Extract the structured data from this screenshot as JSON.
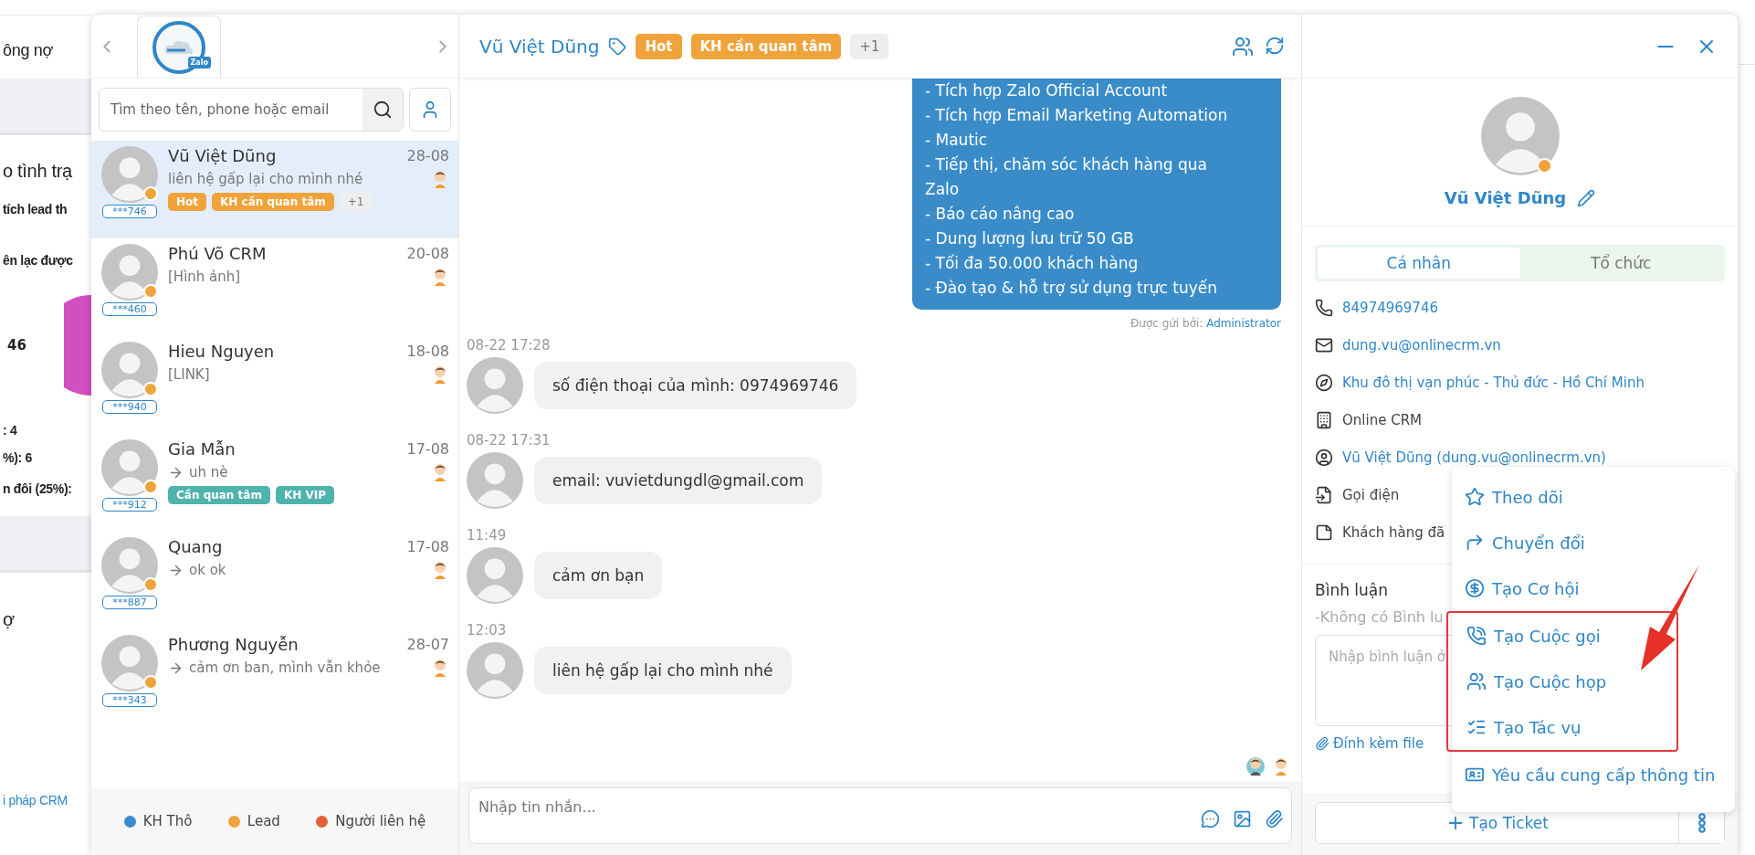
{
  "background": {
    "texts": [
      {
        "kind": "heading",
        "text": "ông nợ"
      },
      {
        "kind": "band"
      },
      {
        "kind": "title",
        "text": "o tình trạ"
      },
      {
        "kind": "bold",
        "text": "tích lead th"
      },
      {
        "kind": "bold",
        "text": "ên lạc được"
      },
      {
        "kind": "chart",
        "text": "46"
      },
      {
        "kind": "bold",
        "text": ": 4"
      },
      {
        "kind": "bold",
        "text": "%): 6"
      },
      {
        "kind": "bold",
        "text": "n đôi (25%):"
      },
      {
        "kind": "band"
      },
      {
        "kind": "title",
        "text": "ợ"
      },
      {
        "kind": "link",
        "text": "i pháp CRM"
      }
    ]
  },
  "contacts_panel": {
    "logo_text": "Zalo",
    "search": {
      "placeholder": "Tìm theo tên, phone hoặc email"
    },
    "contacts": [
      {
        "name": "Vũ Việt Dũng",
        "date": "28-08",
        "preview": "liên hệ gấp lại cho mình nhé",
        "outgoing": false,
        "phone": "***746",
        "color": "#f0a33a",
        "selected": true,
        "tags": [
          {
            "label": "Hot",
            "color": "#f0a33a"
          },
          {
            "label": "KH cần quan tâm",
            "color": "#f0a33a"
          }
        ],
        "more_tags": "+1"
      },
      {
        "name": "Phú Võ CRM",
        "date": "20-08",
        "preview": "[Hình ảnh]",
        "outgoing": false,
        "phone": "***460",
        "color": "#f0a33a",
        "selected": false
      },
      {
        "name": "Hieu Nguyen",
        "date": "18-08",
        "preview": "[LINK]",
        "outgoing": false,
        "phone": "***940",
        "color": "#f0a33a",
        "selected": false
      },
      {
        "name": "Gia Mẫn",
        "date": "17-08",
        "preview": "uh nè",
        "outgoing": true,
        "phone": "***912",
        "color": "#f0a33a",
        "selected": false,
        "tags": [
          {
            "label": "Cần quan tâm",
            "color": "#4fb3ad"
          },
          {
            "label": "KH VIP",
            "color": "#4fb3ad"
          }
        ]
      },
      {
        "name": "Quang",
        "date": "17-08",
        "preview": "ok ok",
        "outgoing": true,
        "phone": "***887",
        "color": "#f0a33a",
        "selected": false
      },
      {
        "name": "Phương Nguyễn",
        "date": "28-07",
        "preview": "cảm ơn ban, mình vẫn khỏe",
        "outgoing": true,
        "phone": "***343",
        "color": "#f0a33a",
        "selected": false
      }
    ],
    "legend": [
      {
        "label": "KH Thô",
        "color": "#3a8ccd"
      },
      {
        "label": "Lead",
        "color": "#f0a33a"
      },
      {
        "label": "Người liên hệ",
        "color": "#e2603a"
      }
    ]
  },
  "chat": {
    "name": "Vũ Việt Dũng",
    "tags": [
      {
        "label": "Hot",
        "color": "#f0a33a"
      },
      {
        "label": "KH cần quan tâm",
        "color": "#f0a33a"
      }
    ],
    "more_tags": "+1",
    "outgoing": {
      "lines": [
        "- Tích hợp Zalo Official Account",
        "- Tích hợp Email Marketing Automation",
        "- Mautic",
        "- Tiếp thị, chăm sóc khách hàng qua Zalo",
        "- Báo cáo nâng cao",
        "- Dung lượng lưu trữ 50 GB",
        "- Tối đa 50.000 khách hàng",
        "- Đào tạo & hỗ trợ sử dụng trực tuyến"
      ],
      "sent_by_label": "Được gửi bởi:",
      "sent_by": "Administrator"
    },
    "messages": [
      {
        "time": "08-22 17:28",
        "text": "số điện thoại của mình: 0974969746"
      },
      {
        "time": "08-22 17:31",
        "text": "email: vuvietdungdl@gmail.com"
      },
      {
        "time": "11:49",
        "text": "cảm ơn bạn"
      },
      {
        "time": "12:03",
        "text": "liên hệ gấp lại cho mình nhé"
      }
    ],
    "input": {
      "placeholder": "Nhập tin nhắn..."
    }
  },
  "profile": {
    "name": "Vũ Việt Dũng",
    "color": "#f0a33a",
    "tabs": [
      {
        "label": "Cá nhân",
        "selected": true
      },
      {
        "label": "Tổ chức",
        "selected": false
      }
    ],
    "details": [
      {
        "kind": "phone",
        "text": "84974969746",
        "link": true
      },
      {
        "kind": "email",
        "text": "dung.vu@onlinecrm.vn",
        "link": true
      },
      {
        "kind": "address",
        "text": "Khu đô thị vạn phúc - Thủ đức - Hồ Chí Minh",
        "link": true
      },
      {
        "kind": "company",
        "text": "Online CRM",
        "link": false
      },
      {
        "kind": "owner",
        "text": "Vũ Việt Dũng (dung.vu@onlinecrm.vn)",
        "link": true
      },
      {
        "kind": "source",
        "text": "Gọi điện",
        "link": false
      },
      {
        "kind": "note",
        "text": "Khách hàng đã",
        "link": false
      }
    ],
    "comments": {
      "title": "Bình luận",
      "empty": "-Không có Bình lu",
      "placeholder": "Nhập bình luận ở",
      "attach": "Đính kèm file"
    },
    "ticket_button": "Tạo Ticket",
    "menu": [
      {
        "kind": "follow",
        "label": "Theo dõi",
        "highlighted": false
      },
      {
        "kind": "convert",
        "label": "Chuyển đổi",
        "highlighted": false
      },
      {
        "kind": "deal",
        "label": "Tạo Cơ hội",
        "highlighted": false
      },
      {
        "kind": "call",
        "label": "Tạo Cuộc gọi",
        "highlighted": true
      },
      {
        "kind": "meeting",
        "label": "Tạo Cuộc họp",
        "highlighted": true
      },
      {
        "kind": "task",
        "label": "Tạo Tác vụ",
        "highlighted": true
      },
      {
        "kind": "request",
        "label": "Yêu cầu cung cấp thông tin",
        "highlighted": false
      }
    ]
  }
}
